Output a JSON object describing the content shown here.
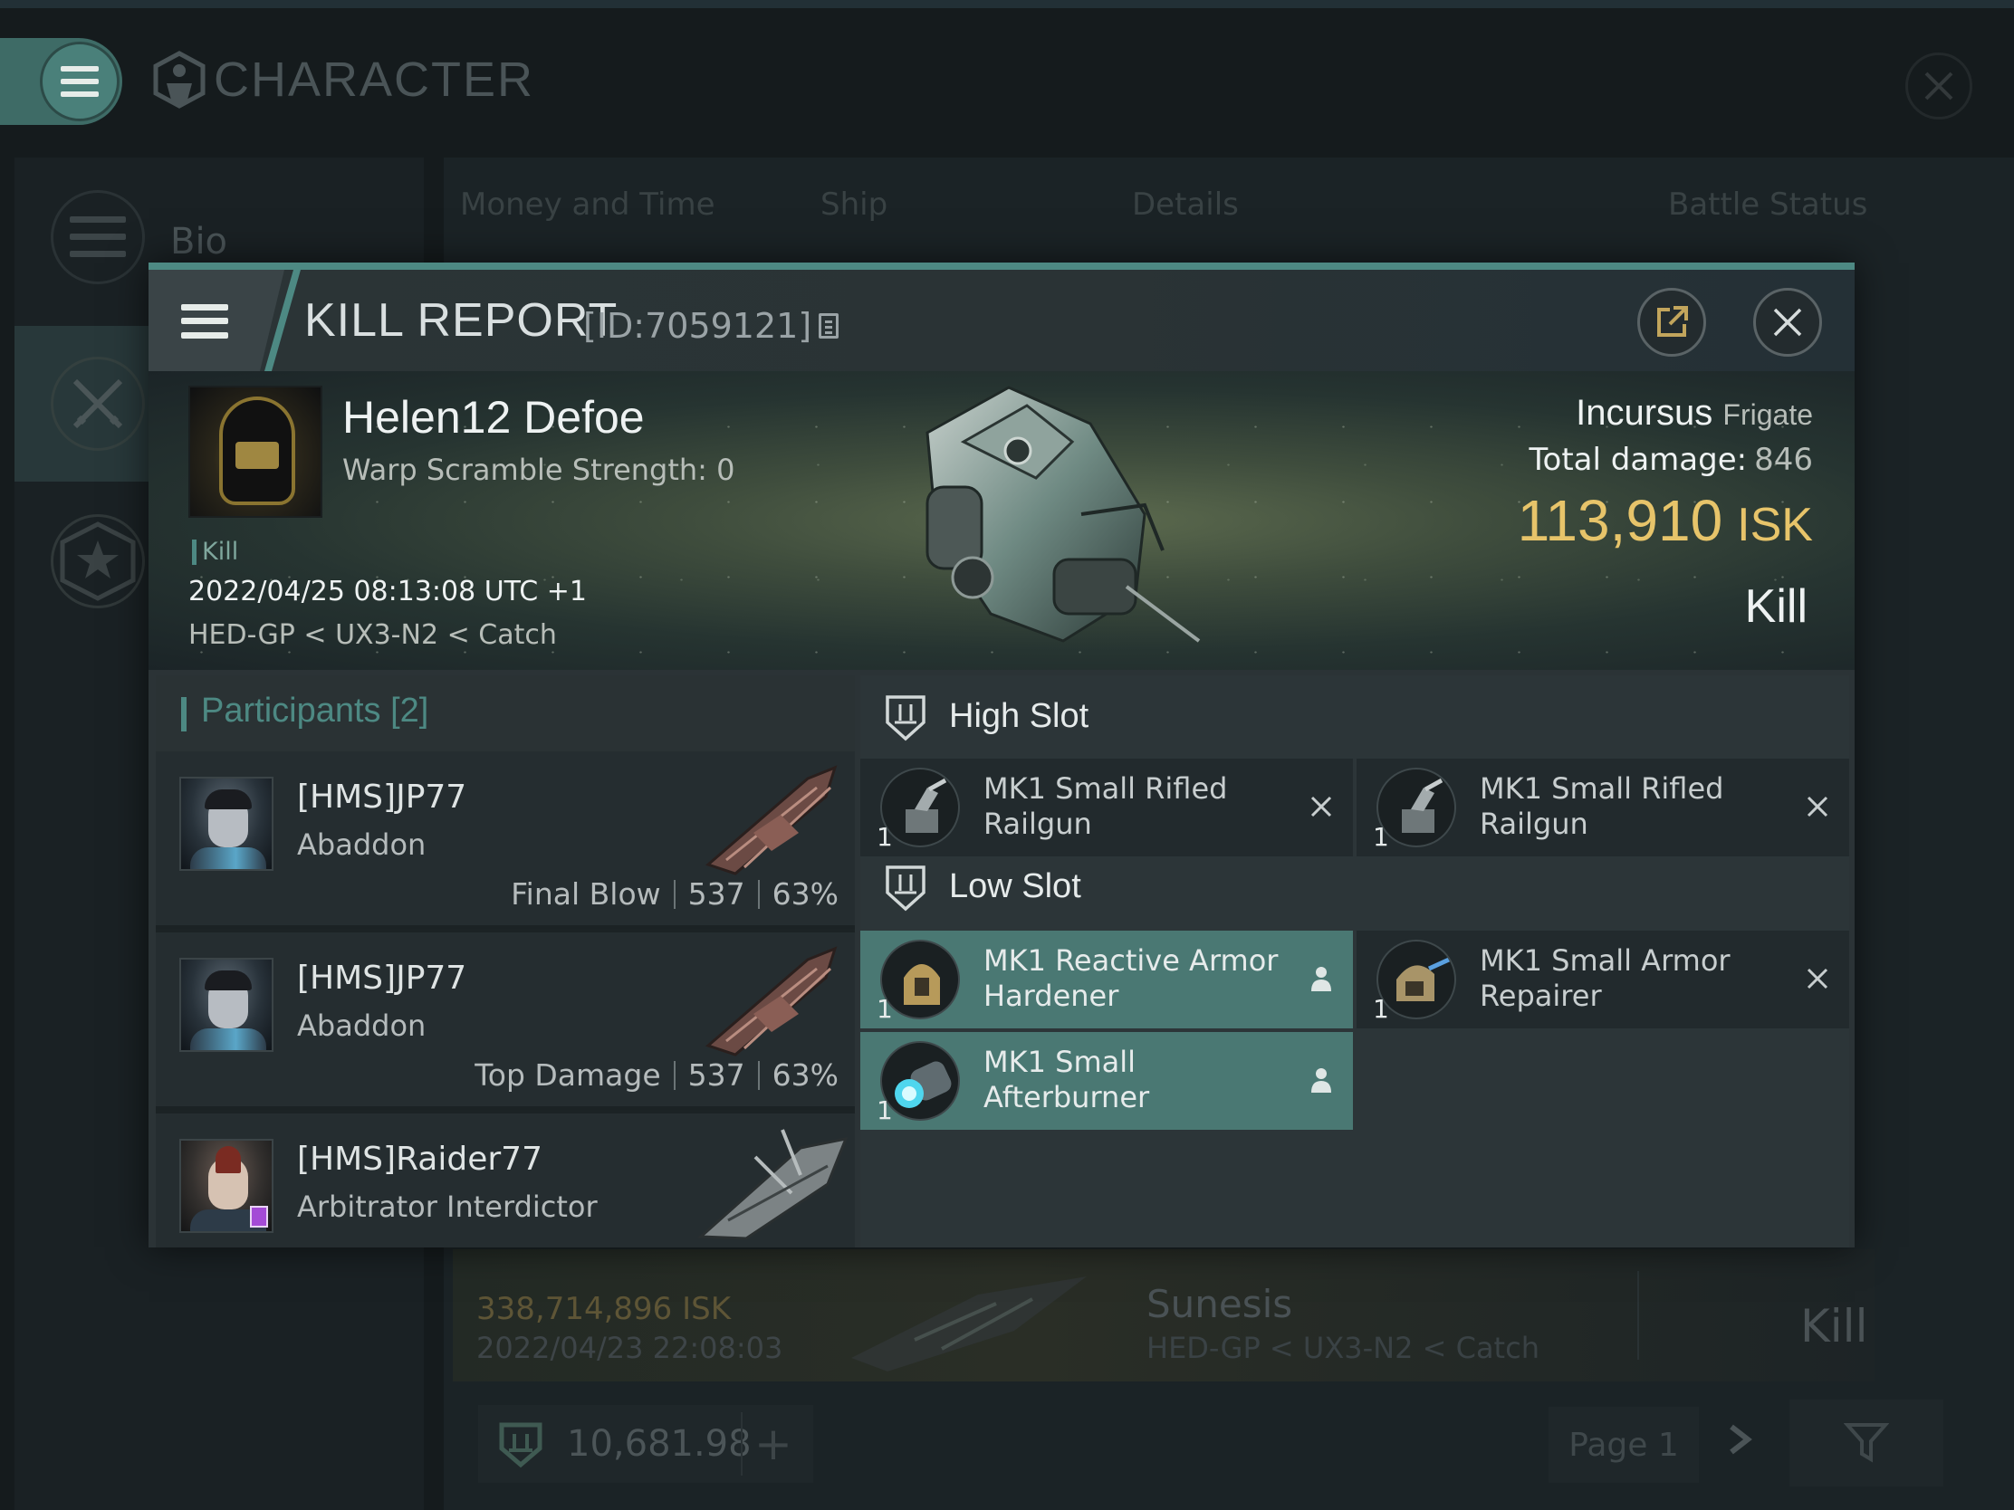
{
  "app": {
    "title": "CHARACTER"
  },
  "sidebar": {
    "items": [
      {
        "label": "Bio"
      },
      {
        "label": ""
      },
      {
        "label": ""
      }
    ]
  },
  "tabs": [
    "Money and Time",
    "Ship",
    "Details",
    "Battle Status"
  ],
  "background_kill": {
    "isk": "338,714,896  ISK",
    "date": "2022/04/23  22:08:03",
    "ship": "Sunesis",
    "location": "HED-GP < UX3-N2 < Catch",
    "result": "Kill"
  },
  "footer": {
    "balance": "10,681.98",
    "add": "+",
    "page": "Page 1"
  },
  "kill_report": {
    "title": "KILL REPORT",
    "id": "[ID:7059121]",
    "victim": {
      "name": "Helen12 Defoe",
      "warp_scramble": "Warp Scramble Strength: 0",
      "tag": "Kill",
      "datetime": "2022/04/25 08:13:08 UTC +1",
      "location": "HED-GP < UX3-N2 < Catch"
    },
    "ship_name": "Incursus",
    "ship_class": "Frigate",
    "total_damage_label": "Total damage:",
    "total_damage": "846",
    "isk_value": "113,910",
    "isk_unit": "ISK",
    "result": "Kill",
    "participants_label": "Participants",
    "participants_count": "[2]",
    "participants": [
      {
        "name": "[HMS]JP77",
        "ship": "Abaddon",
        "role": "Final Blow",
        "damage": "537",
        "percent": "63%"
      },
      {
        "name": "[HMS]JP77",
        "ship": "Abaddon",
        "role": "Top Damage",
        "damage": "537",
        "percent": "63%"
      },
      {
        "name": "[HMS]Raider77",
        "ship": "Arbitrator Interdictor",
        "role": "",
        "damage": "",
        "percent": ""
      }
    ],
    "high_slot": {
      "label": "High Slot",
      "modules": [
        {
          "qty": "1",
          "name": "MK1 Small Rifled Railgun",
          "status": "destroyed"
        },
        {
          "qty": "1",
          "name": "MK1 Small Rifled Railgun",
          "status": "destroyed"
        }
      ]
    },
    "low_slot": {
      "label": "Low Slot",
      "modules": [
        {
          "qty": "1",
          "name": "MK1 Reactive Armor Hardener",
          "status": "dropped"
        },
        {
          "qty": "1",
          "name": "MK1 Small Armor Repairer",
          "status": "destroyed"
        },
        {
          "qty": "1",
          "name": "MK1 Small Afterburner",
          "status": "dropped"
        }
      ]
    }
  },
  "colors": {
    "accent": "#4d8983",
    "isk": "#e7c46a",
    "dropped_bg": "#4a7873"
  }
}
